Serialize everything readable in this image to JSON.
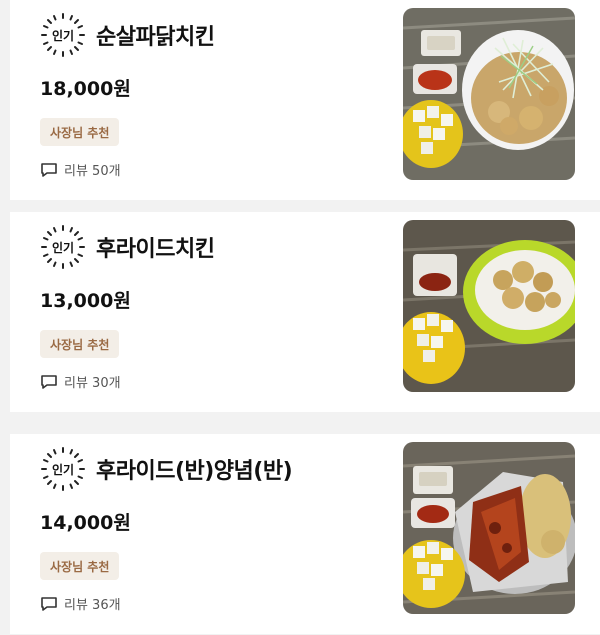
{
  "menu": {
    "items": [
      {
        "badge": "인기",
        "name": "순살파닭치킨",
        "price": "18,000원",
        "tag": "사장님 추천",
        "reviews": "리뷰 50개"
      },
      {
        "badge": "인기",
        "name": "후라이드치킨",
        "price": "13,000원",
        "tag": "사장님 추천",
        "reviews": "리뷰 30개"
      },
      {
        "badge": "인기",
        "name": "후라이드(반)양념(반)",
        "price": "14,000원",
        "tag": "사장님 추천",
        "reviews": "리뷰 36개"
      }
    ]
  },
  "colors": {
    "tag_bg": "#f3eee7",
    "tag_text": "#9a6a44"
  }
}
